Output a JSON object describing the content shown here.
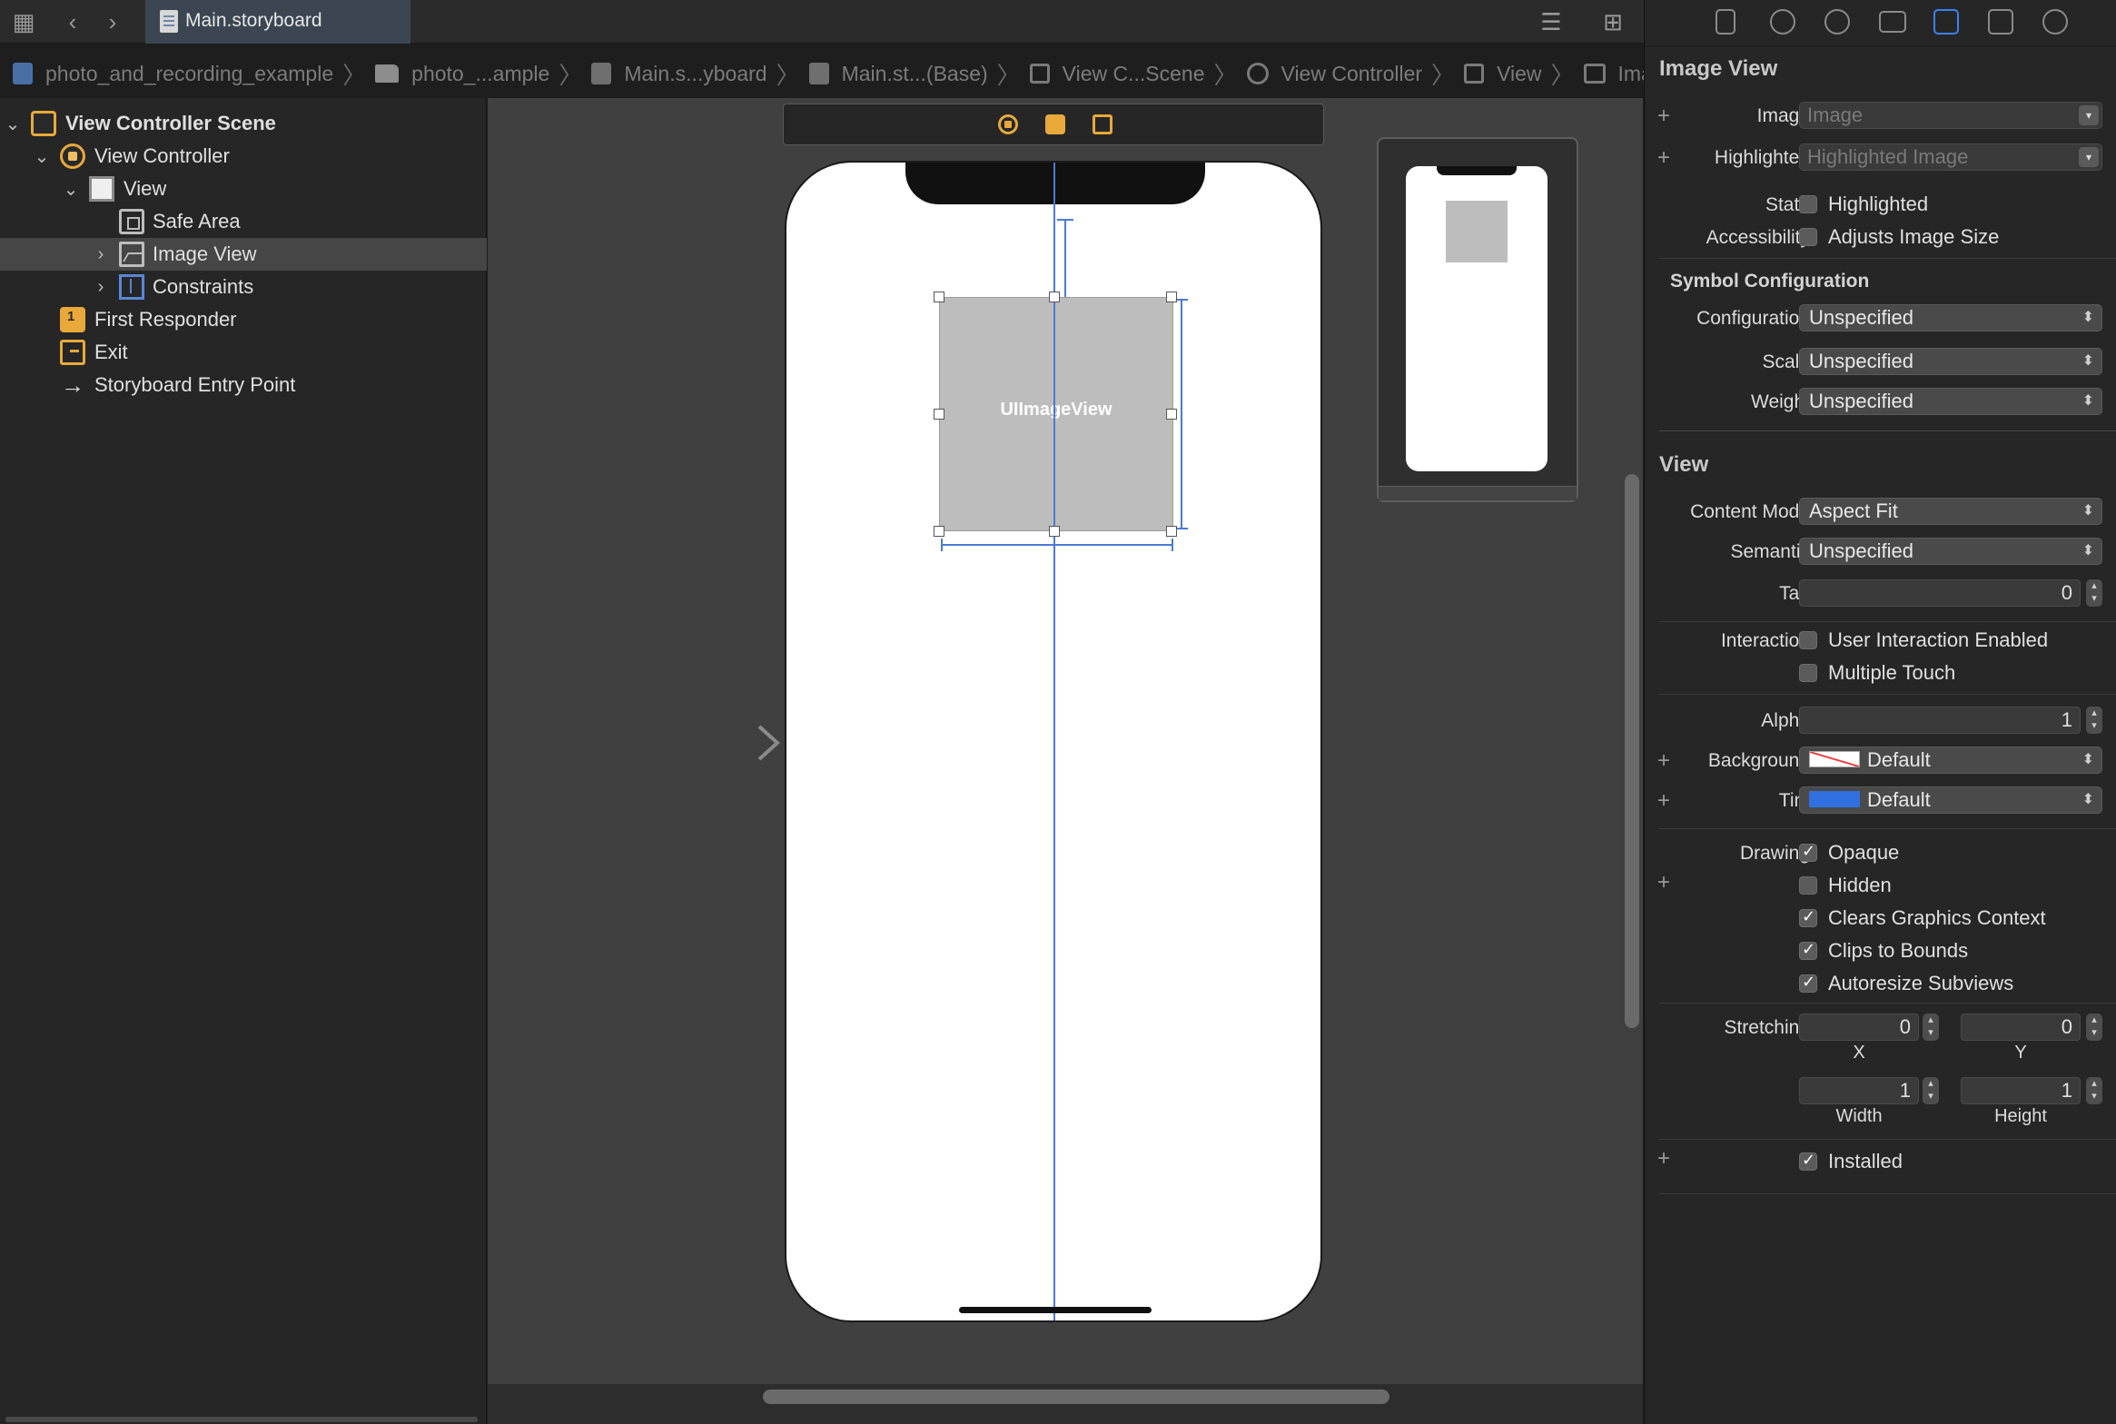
{
  "toolbar": {
    "tab_title": "Main.storyboard"
  },
  "breadcrumb": [
    {
      "label": "photo_and_recording_example",
      "icon": "project-icon"
    },
    {
      "label": "photo_...ample",
      "icon": "folder-icon"
    },
    {
      "label": "Main.s...yboard",
      "icon": "storyboard-file-icon"
    },
    {
      "label": "Main.st...(Base)",
      "icon": "storyboard-file-icon"
    },
    {
      "label": "View C...Scene",
      "icon": "scene-icon"
    },
    {
      "label": "View Controller",
      "icon": "view-controller-icon"
    },
    {
      "label": "View",
      "icon": "view-icon"
    },
    {
      "label": "Image View",
      "icon": "image-view-icon"
    }
  ],
  "navigator": {
    "items": [
      {
        "label": "View Controller Scene",
        "icon": "scene-icon",
        "expanded": true
      },
      {
        "label": "View Controller",
        "icon": "view-controller-icon",
        "expanded": true
      },
      {
        "label": "View",
        "icon": "view-icon",
        "expanded": true
      },
      {
        "label": "Safe Area",
        "icon": "safe-area-icon"
      },
      {
        "label": "Image View",
        "icon": "image-view-icon",
        "expanded": false,
        "selected": true
      },
      {
        "label": "Constraints",
        "icon": "constraints-icon",
        "expanded": false
      },
      {
        "label": "First Responder",
        "icon": "first-responder-icon"
      },
      {
        "label": "Exit",
        "icon": "exit-icon"
      },
      {
        "label": "Storyboard Entry Point",
        "icon": "entry-arrow-icon"
      }
    ]
  },
  "canvas": {
    "imageview_label": "UIImageView"
  },
  "inspector": {
    "title": "Image View",
    "image": {
      "label": "Image",
      "placeholder": "Image"
    },
    "highlighted": {
      "label": "Highlighted",
      "placeholder": "Highlighted Image"
    },
    "state": {
      "label": "State",
      "checkbox": "Highlighted",
      "checked": false
    },
    "accessibility": {
      "label": "Accessibility",
      "checkbox": "Adjusts Image Size",
      "checked": false
    },
    "symbol_config": {
      "title": "Symbol Configuration",
      "configuration": {
        "label": "Configuration",
        "value": "Unspecified"
      },
      "scale": {
        "label": "Scale",
        "value": "Unspecified"
      },
      "weight": {
        "label": "Weight",
        "value": "Unspecified"
      }
    },
    "view": {
      "title": "View",
      "content_mode": {
        "label": "Content Mode",
        "value": "Aspect Fit"
      },
      "semantic": {
        "label": "Semantic",
        "value": "Unspecified"
      },
      "tag": {
        "label": "Tag",
        "value": "0"
      },
      "interaction": {
        "label": "Interaction",
        "user_interaction": {
          "text": "User Interaction Enabled",
          "checked": false
        },
        "multiple_touch": {
          "text": "Multiple Touch",
          "checked": false
        }
      },
      "alpha": {
        "label": "Alpha",
        "value": "1"
      },
      "background": {
        "label": "Background",
        "value": "Default"
      },
      "tint": {
        "label": "Tint",
        "value": "Default",
        "color": "#2f6fe0"
      },
      "drawing": {
        "label": "Drawing",
        "opaque": {
          "text": "Opaque",
          "checked": true
        },
        "hidden": {
          "text": "Hidden",
          "checked": false
        },
        "clears": {
          "text": "Clears Graphics Context",
          "checked": true
        },
        "clips": {
          "text": "Clips to Bounds",
          "checked": true
        },
        "autoresize": {
          "text": "Autoresize Subviews",
          "checked": true
        }
      },
      "stretching": {
        "label": "Stretching",
        "x": "0",
        "y": "0",
        "width": "1",
        "height": "1",
        "x_label": "X",
        "y_label": "Y",
        "width_label": "Width",
        "height_label": "Height"
      },
      "installed": {
        "text": "Installed",
        "checked": true
      }
    }
  }
}
